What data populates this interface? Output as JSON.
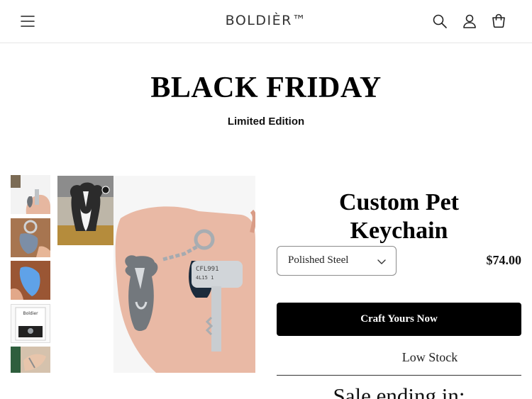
{
  "header": {
    "logo": "BOLDIÈR™",
    "icons": [
      "menu-icon",
      "search-icon",
      "account-icon",
      "cart-icon"
    ]
  },
  "hero": {
    "title": "BLACK FRIDAY",
    "subtitle": "Limited Edition"
  },
  "gallery": {
    "thumbnail_count": 5,
    "box_label": "Boldier"
  },
  "product": {
    "title_line1": "Custom Pet",
    "title_line2": "Keychain",
    "variant": {
      "selected": "Polished Steel"
    },
    "price": "$74.00",
    "cta_label": "Craft Yours Now",
    "stock_label": "Low Stock",
    "sale_text": "Sale ending in:"
  },
  "colors": {
    "cta_background": "#000000",
    "cta_text": "#ffffff",
    "accent": "#111111"
  }
}
